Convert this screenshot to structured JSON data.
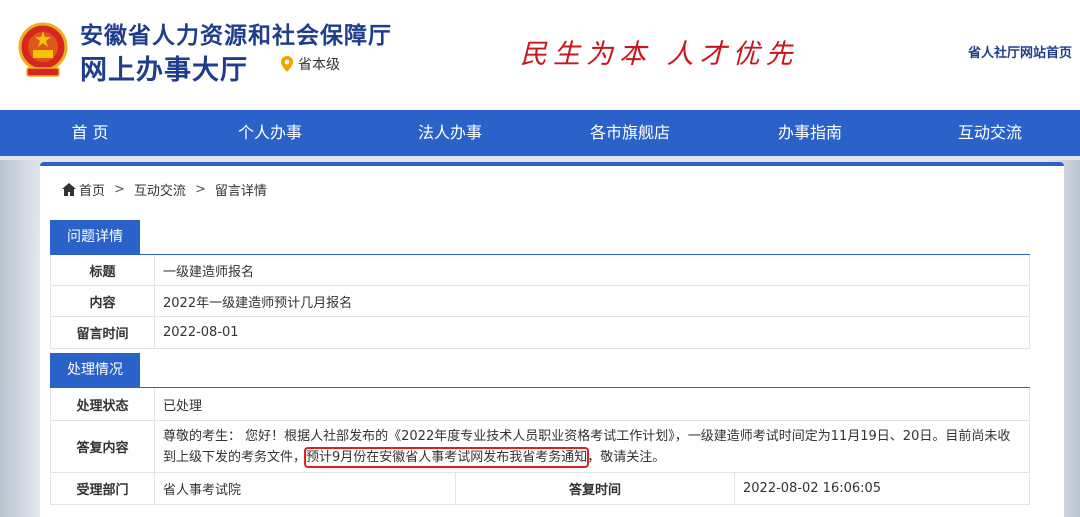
{
  "header": {
    "title_main": "安徽省人力资源和社会保障厅",
    "title_sub": "网上办事大厅",
    "location": "省本级",
    "slogan": "民生为本 人才优先",
    "home_link": "省人社厅网站首页"
  },
  "nav": {
    "items": [
      "首 页",
      "个人办事",
      "法人办事",
      "各市旗舰店",
      "办事指南",
      "互动交流"
    ]
  },
  "breadcrumb": {
    "home": "首页",
    "sep": ">",
    "level2": "互动交流",
    "level3": "留言详情"
  },
  "question": {
    "section_title": "问题详情",
    "title_label": "标题",
    "title_value": "一级建造师报名",
    "content_label": "内容",
    "content_value": "2022年一级建造师预计几月报名",
    "time_label": "留言时间",
    "time_value": "2022-08-01"
  },
  "handling": {
    "section_title": "处理情况",
    "status_label": "处理状态",
    "status_value": "已处理",
    "reply_label": "答复内容",
    "reply_part1": "尊敬的考生： 您好！根据人社部发布的《2022年度专业技术人员职业资格考试工作计划》，一级建造师考试时间定为11月19日、20日。目前尚未收到上级下发的考务文件，",
    "reply_highlight": "预计9月份在安徽省人事考试网发布我省考务通知",
    "reply_part2": "，敬请关注。",
    "dept_label": "受理部门",
    "dept_value": "省人事考试院",
    "reply_time_label": "答复时间",
    "reply_time_value": "2022-08-02 16:06:05"
  },
  "colors": {
    "nav_blue": "#2a62c9",
    "title_blue": "#1e3e8c",
    "slogan_red": "#c8161d",
    "highlight_red": "#e02020"
  }
}
